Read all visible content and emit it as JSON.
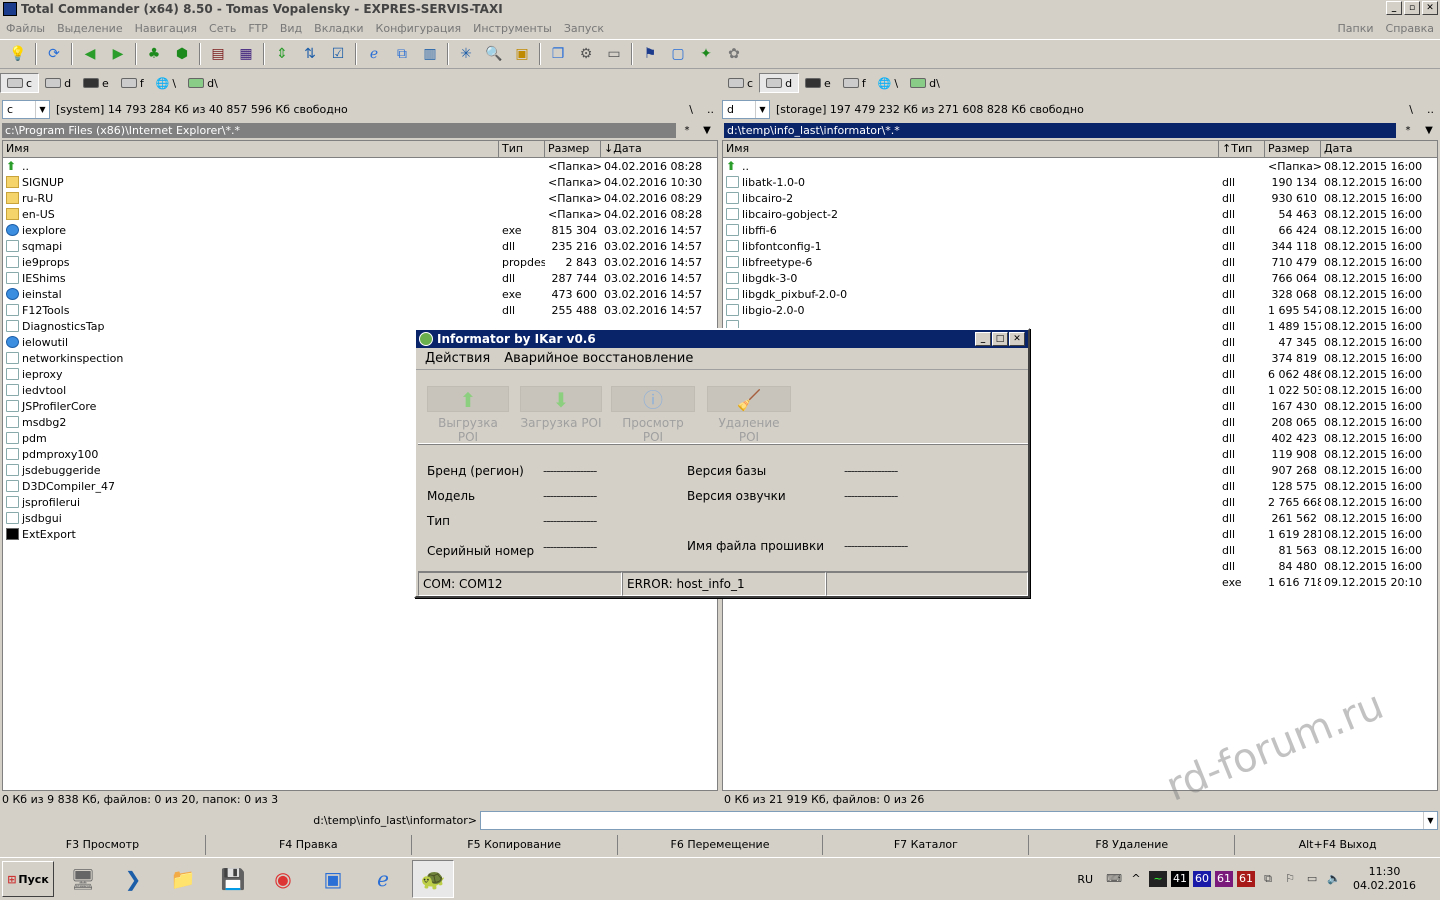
{
  "window": {
    "title": "Total Commander (x64) 8.50 - Tomas Vopalensky - EXPRES-SERVIS-TAXI"
  },
  "menu": {
    "left": [
      "Файлы",
      "Выделение",
      "Навигация",
      "Сеть",
      "FTP",
      "Вид",
      "Вкладки",
      "Конфигурация",
      "Инструменты",
      "Запуск"
    ],
    "right": [
      "Папки",
      "Справка"
    ]
  },
  "toolbar_icons": [
    "lightbulb-icon",
    "refresh-icon",
    "back-icon",
    "forward-icon",
    "pack-icon",
    "unpack-icon",
    "books-icon",
    "book-icon",
    "sync-icon",
    "sort-icon",
    "check-icon",
    "ie-icon",
    "network-icon",
    "grid-icon",
    "select-icon",
    "search-icon",
    "view-icon",
    "copy-icon",
    "settings-icon",
    "calc-icon",
    "flag-icon",
    "display-icon",
    "tools-icon",
    "plugin-icon"
  ],
  "drives": [
    "c",
    "d",
    "e",
    "f",
    "\\",
    "d\\"
  ],
  "left": {
    "drive": "c",
    "drive_info": "[system]  14 793 284 Кб из 40 857 596 Кб свободно",
    "root_btn": "\\",
    "up_btn": "..",
    "path": "c:\\Program Files (x86)\\Internet Explorer\\*.*",
    "cols": {
      "name": "Имя",
      "ext": "Тип",
      "size": "Размер",
      "date": "Дата"
    },
    "files": [
      {
        "icon": "up",
        "name": "..",
        "ext": "",
        "size": "<Папка>",
        "date": "04.02.2016 08:28"
      },
      {
        "icon": "folder",
        "name": "SIGNUP",
        "ext": "",
        "size": "<Папка>",
        "date": "04.02.2016 10:30"
      },
      {
        "icon": "folder",
        "name": "ru-RU",
        "ext": "",
        "size": "<Папка>",
        "date": "04.02.2016 08:29"
      },
      {
        "icon": "folder",
        "name": "en-US",
        "ext": "",
        "size": "<Папка>",
        "date": "04.02.2016 08:28"
      },
      {
        "icon": "ie",
        "name": "iexplore",
        "ext": "exe",
        "size": "815 304",
        "date": "03.02.2016 14:57"
      },
      {
        "icon": "file",
        "name": "sqmapi",
        "ext": "dll",
        "size": "235 216",
        "date": "03.02.2016 14:57"
      },
      {
        "icon": "file",
        "name": "ie9props",
        "ext": "propdesc",
        "size": "2 843",
        "date": "03.02.2016 14:57"
      },
      {
        "icon": "file",
        "name": "IEShims",
        "ext": "dll",
        "size": "287 744",
        "date": "03.02.2016 14:57"
      },
      {
        "icon": "ie",
        "name": "ieinstal",
        "ext": "exe",
        "size": "473 600",
        "date": "03.02.2016 14:57"
      },
      {
        "icon": "file",
        "name": "F12Tools",
        "ext": "dll",
        "size": "255 488",
        "date": "03.02.2016 14:57"
      },
      {
        "icon": "file",
        "name": "DiagnosticsTap",
        "ext": "",
        "size": "",
        "date": ""
      },
      {
        "icon": "ie",
        "name": "ielowutil",
        "ext": "",
        "size": "",
        "date": ""
      },
      {
        "icon": "file",
        "name": "networkinspection",
        "ext": "",
        "size": "",
        "date": ""
      },
      {
        "icon": "file",
        "name": "ieproxy",
        "ext": "",
        "size": "",
        "date": ""
      },
      {
        "icon": "file",
        "name": "iedvtool",
        "ext": "",
        "size": "",
        "date": ""
      },
      {
        "icon": "file",
        "name": "JSProfilerCore",
        "ext": "",
        "size": "",
        "date": ""
      },
      {
        "icon": "file",
        "name": "msdbg2",
        "ext": "",
        "size": "",
        "date": ""
      },
      {
        "icon": "file",
        "name": "pdm",
        "ext": "",
        "size": "",
        "date": ""
      },
      {
        "icon": "file",
        "name": "pdmproxy100",
        "ext": "",
        "size": "",
        "date": ""
      },
      {
        "icon": "file",
        "name": "jsdebuggeride",
        "ext": "",
        "size": "",
        "date": ""
      },
      {
        "icon": "file",
        "name": "D3DCompiler_47",
        "ext": "",
        "size": "",
        "date": ""
      },
      {
        "icon": "file",
        "name": "jsprofilerui",
        "ext": "",
        "size": "",
        "date": ""
      },
      {
        "icon": "file",
        "name": "jsdbgui",
        "ext": "",
        "size": "",
        "date": ""
      },
      {
        "icon": "cmd",
        "name": "ExtExport",
        "ext": "",
        "size": "",
        "date": ""
      }
    ],
    "status": "0 Кб из 9 838 Кб, файлов: 0 из 20, папок: 0 из 3"
  },
  "right": {
    "drive": "d",
    "drive_info": "[storage]  197 479 232 Кб из 271 608 828 Кб свободно",
    "root_btn": "\\",
    "up_btn": "..",
    "path": "d:\\temp\\info_last\\informator\\*.*",
    "cols": {
      "name": "Имя",
      "ext": "Тип",
      "size": "Размер",
      "date": "Дата"
    },
    "files": [
      {
        "icon": "up",
        "name": "..",
        "ext": "",
        "size": "<Папка>",
        "date": "08.12.2015 16:00"
      },
      {
        "icon": "file",
        "name": "libatk-1.0-0",
        "ext": "dll",
        "size": "190 134",
        "date": "08.12.2015 16:00"
      },
      {
        "icon": "file",
        "name": "libcairo-2",
        "ext": "dll",
        "size": "930 610",
        "date": "08.12.2015 16:00"
      },
      {
        "icon": "file",
        "name": "libcairo-gobject-2",
        "ext": "dll",
        "size": "54 463",
        "date": "08.12.2015 16:00"
      },
      {
        "icon": "file",
        "name": "libffi-6",
        "ext": "dll",
        "size": "66 424",
        "date": "08.12.2015 16:00"
      },
      {
        "icon": "file",
        "name": "libfontconfig-1",
        "ext": "dll",
        "size": "344 118",
        "date": "08.12.2015 16:00"
      },
      {
        "icon": "file",
        "name": "libfreetype-6",
        "ext": "dll",
        "size": "710 479",
        "date": "08.12.2015 16:00"
      },
      {
        "icon": "file",
        "name": "libgdk-3-0",
        "ext": "dll",
        "size": "766 064",
        "date": "08.12.2015 16:00"
      },
      {
        "icon": "file",
        "name": "libgdk_pixbuf-2.0-0",
        "ext": "dll",
        "size": "328 068",
        "date": "08.12.2015 16:00"
      },
      {
        "icon": "file",
        "name": "libgio-2.0-0",
        "ext": "dll",
        "size": "1 695 547",
        "date": "08.12.2015 16:00"
      },
      {
        "icon": "file",
        "name": "",
        "ext": "dll",
        "size": "1 489 157",
        "date": "08.12.2015 16:00"
      },
      {
        "icon": "",
        "name": "",
        "ext": "dll",
        "size": "47 345",
        "date": "08.12.2015 16:00"
      },
      {
        "icon": "",
        "name": "",
        "ext": "dll",
        "size": "374 819",
        "date": "08.12.2015 16:00"
      },
      {
        "icon": "",
        "name": "",
        "ext": "dll",
        "size": "6 062 486",
        "date": "08.12.2015 16:00"
      },
      {
        "icon": "",
        "name": "",
        "ext": "dll",
        "size": "1 022 503",
        "date": "08.12.2015 16:00"
      },
      {
        "icon": "",
        "name": "",
        "ext": "dll",
        "size": "167 430",
        "date": "08.12.2015 16:00"
      },
      {
        "icon": "",
        "name": "",
        "ext": "dll",
        "size": "208 065",
        "date": "08.12.2015 16:00"
      },
      {
        "icon": "",
        "name": "",
        "ext": "dll",
        "size": "402 423",
        "date": "08.12.2015 16:00"
      },
      {
        "icon": "",
        "name": "",
        "ext": "dll",
        "size": "119 908",
        "date": "08.12.2015 16:00"
      },
      {
        "icon": "",
        "name": "",
        "ext": "dll",
        "size": "907 268",
        "date": "08.12.2015 16:00"
      },
      {
        "icon": "",
        "name": "",
        "ext": "dll",
        "size": "128 575",
        "date": "08.12.2015 16:00"
      },
      {
        "icon": "",
        "name": "",
        "ext": "dll",
        "size": "2 765 668",
        "date": "08.12.2015 16:00"
      },
      {
        "icon": "",
        "name": "",
        "ext": "dll",
        "size": "261 562",
        "date": "08.12.2015 16:00"
      },
      {
        "icon": "",
        "name": "",
        "ext": "dll",
        "size": "1 619 281",
        "date": "08.12.2015 16:00"
      },
      {
        "icon": "",
        "name": "",
        "ext": "dll",
        "size": "81 563",
        "date": "08.12.2015 16:00"
      },
      {
        "icon": "",
        "name": "",
        "ext": "dll",
        "size": "84 480",
        "date": "08.12.2015 16:00"
      },
      {
        "icon": "",
        "name": "",
        "ext": "exe",
        "size": "1 616 718",
        "date": "09.12.2015 20:10"
      }
    ],
    "status": "0 Кб из 21 919 Кб, файлов: 0 из 26"
  },
  "cmdline": {
    "path": "d:\\temp\\info_last\\informator>",
    "value": ""
  },
  "fkeys": [
    "F3 Просмотр",
    "F4 Правка",
    "F5 Копирование",
    "F6 Перемещение",
    "F7 Каталог",
    "F8 Удаление",
    "Alt+F4 Выход"
  ],
  "dialog": {
    "title": "Informator by IKar v0.6",
    "menu": [
      "Действия",
      "Аварийное восстановление"
    ],
    "buttons": [
      "Выгрузка POI",
      "Загрузка POI",
      "Просмотр POI",
      "Удаление POI"
    ],
    "fields": {
      "brand_label": "Бренд (регион)",
      "brand_value": "----------------",
      "model_label": "Модель",
      "model_value": "----------------",
      "type_label": "Тип",
      "type_value": "----------------",
      "serial_label": "Серийный номер",
      "serial_value": "----------------",
      "db_label": "Версия базы",
      "db_value": "----------------",
      "voice_label": "Версия озвучки",
      "voice_value": "----------------",
      "fw_label": "Имя файла прошивки",
      "fw_value": "-------------------"
    },
    "status": [
      "COM: COM12",
      "ERROR: host_info_1",
      ""
    ]
  },
  "taskbar": {
    "start": "Пуск",
    "lang": "RU",
    "tray_numbers": [
      "41",
      "60",
      "61",
      "61"
    ],
    "time": "11:30",
    "date": "04.02.2016"
  },
  "watermark": "rd-forum.ru"
}
